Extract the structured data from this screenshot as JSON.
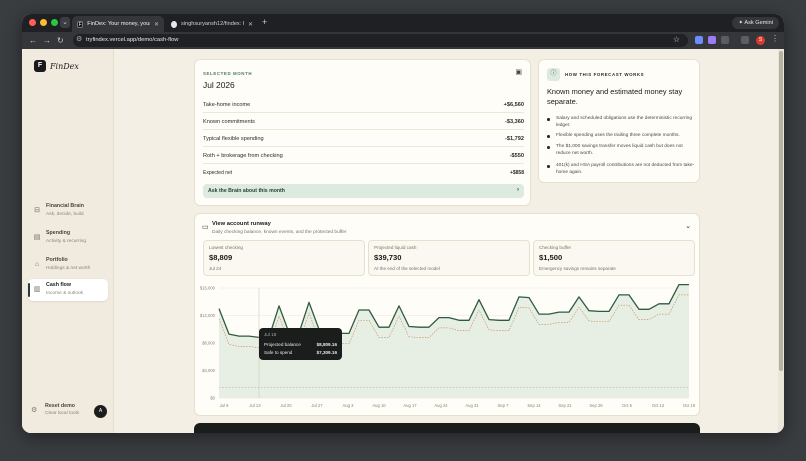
{
  "browser": {
    "tabs": [
      {
        "title": "FinDex: Your money, your tools",
        "favicon": "F"
      },
      {
        "title": "singhsuryansh12/findex: FinDex"
      }
    ],
    "ask_gemini": "Ask Gemini",
    "url": "tryfindex.vercel.app/demo/cash-flow",
    "profile_initial": "S"
  },
  "app": {
    "brand_mark": "F",
    "brand_name": "FinDex",
    "nav": [
      {
        "title": "Financial Brain",
        "subtitle": "Ask, decide, build",
        "icon": "brain-icon"
      },
      {
        "title": "Spending",
        "subtitle": "Activity & recurring",
        "icon": "receipt-icon"
      },
      {
        "title": "Portfolio",
        "subtitle": "Holdings & net worth",
        "icon": "bank-icon"
      },
      {
        "title": "Cash flow",
        "subtitle": "Income & outlook",
        "icon": "chart-icon",
        "active": true
      }
    ],
    "reset": {
      "title": "Reset demo",
      "subtitle": "Clear local tools"
    },
    "user_initial": "A"
  },
  "selected_month": {
    "eyebrow": "SELECTED MONTH",
    "month": "Jul 2026",
    "rows": [
      {
        "label": "Take-home income",
        "value": "+$6,560"
      },
      {
        "label": "Known commitments",
        "value": "-$3,360"
      },
      {
        "label": "Typical flexible spending",
        "value": "-$1,792"
      },
      {
        "label": "Roth + brokerage from checking",
        "value": "-$550"
      },
      {
        "label": "Expected net",
        "value": "+$858"
      }
    ],
    "ask_button": "Ask the Brain about this month"
  },
  "forecast_info": {
    "eyebrow": "HOW THIS FORECAST WORKS",
    "heading": "Known money and estimated money stay separate.",
    "bullets": [
      "Salary and scheduled obligations use the deterministic recurring ledger.",
      "Flexible spending uses the trailing three complete months.",
      "The $1,000 savings transfer moves liquid cash but does not reduce net worth.",
      "401(k) and HSA payroll contributions are not deducted from take-home again."
    ]
  },
  "runway": {
    "title": "View account runway",
    "subtitle": "Daily checking balance, known events, and the protected buffer",
    "stats": [
      {
        "label": "Lowest checking",
        "value": "$8,809",
        "sub": "Jul 24"
      },
      {
        "label": "Projected liquid cash",
        "value": "$39,730",
        "sub": "At the end of the selected model"
      },
      {
        "label": "Checking buffer",
        "value": "$1,500",
        "sub": "Emergency savings remains separate"
      }
    ],
    "tooltip": {
      "date": "Jul 18",
      "projected_label": "Projected balance",
      "projected_value": "$8,809.16",
      "safe_label": "Safe to spend",
      "safe_value": "$7,309.16"
    }
  },
  "chart_data": {
    "type": "area",
    "title": "",
    "xlabel": "",
    "ylabel": "",
    "y_ticks": [
      "$0",
      "$4,000",
      "$8,000",
      "$12,000",
      "$16,000"
    ],
    "ylim": [
      0,
      16000
    ],
    "x_ticks": [
      "Jul 6",
      "Jul 13",
      "Jul 20",
      "Jul 27",
      "Aug 3",
      "Aug 10",
      "Aug 17",
      "Aug 24",
      "Aug 31",
      "Sep 7",
      "Sep 14",
      "Sep 21",
      "Sep 28",
      "Oct 5",
      "Oct 12",
      "Oct 19"
    ],
    "grid": true,
    "series": [
      {
        "color": "#2f5a42",
        "values": [
          13000,
          9300,
          9000,
          9000,
          8809,
          8809,
          13400,
          9500,
          9450,
          13900,
          10000,
          9900,
          9400,
          9400,
          12800,
          12800,
          10300,
          10300,
          13400,
          10400,
          10300,
          10300,
          11700,
          11700,
          11300,
          11300,
          14300,
          11400,
          11300,
          11300,
          14700,
          14600,
          12200,
          12200,
          12500,
          12500,
          14700,
          12700,
          12600,
          12600,
          15000,
          15000,
          12900,
          12900,
          13700,
          13700,
          16500,
          16500
        ]
      },
      {
        "color": "#c79a6a",
        "values": [
          11500,
          7800,
          7500,
          7500,
          7309,
          7309,
          11900,
          8000,
          7950,
          12400,
          8500,
          8400,
          7900,
          7900,
          11300,
          11300,
          8800,
          8800,
          11900,
          8900,
          8800,
          8800,
          10200,
          10200,
          9800,
          9800,
          12800,
          9900,
          9800,
          9800,
          13200,
          13100,
          10700,
          10700,
          11000,
          11000,
          13200,
          11200,
          11100,
          11100,
          13500,
          13500,
          11400,
          11400,
          12200,
          12200,
          15000,
          15000
        ]
      },
      {
        "color": "#b9b4aa",
        "values": [
          1500,
          1500,
          1500,
          1500,
          1500,
          1500,
          1500,
          1500,
          1500,
          1500,
          1500,
          1500,
          1500,
          1500,
          1500,
          1500,
          1500,
          1500,
          1500,
          1500,
          1500,
          1500,
          1500,
          1500,
          1500,
          1500,
          1500,
          1500,
          1500,
          1500,
          1500,
          1500,
          1500,
          1500,
          1500,
          1500,
          1500,
          1500,
          1500,
          1500,
          1500,
          1500,
          1500,
          1500,
          1500,
          1500,
          1500,
          1500
        ]
      }
    ]
  },
  "colors": {
    "accent": "#2f5a42",
    "background": "#f4efe4",
    "card": "#fffdf8",
    "ask_button_bg": "#dceadf"
  }
}
